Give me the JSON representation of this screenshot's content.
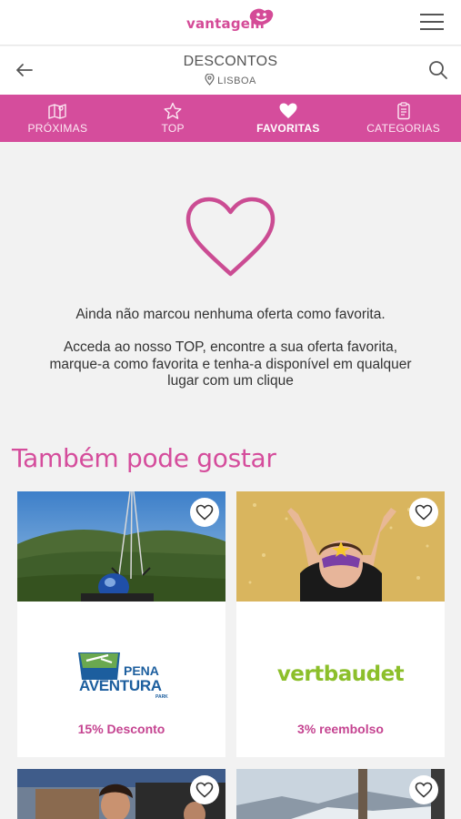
{
  "brand": {
    "name": "vantagem",
    "color": "#d54d9c"
  },
  "header": {
    "title": "DESCONTOS",
    "location": "LISBOA"
  },
  "tabs": [
    {
      "label": "PRÓXIMAS",
      "icon": "map-icon",
      "active": false
    },
    {
      "label": "TOP",
      "icon": "star-icon",
      "active": false
    },
    {
      "label": "FAVORITAS",
      "icon": "heart-icon",
      "active": true
    },
    {
      "label": "CATEGORIAS",
      "icon": "clipboard-icon",
      "active": false
    }
  ],
  "empty_state": {
    "message": "Ainda não marcou nenhuma oferta como favorita.",
    "hint": "Acceda ao nosso TOP, encontre a sua oferta favorita, marque-a como favorita e tenha-a disponível em qualquer lugar com um clique"
  },
  "recommendations": {
    "title": "Também pode gostar",
    "cards": [
      {
        "brand_text_1": "PENA",
        "brand_text_2": "AVENTURA",
        "brand_text_3": "PARK",
        "deal": "15% Desconto"
      },
      {
        "brand_text": "vertbaudet",
        "deal": "3% reembolso"
      }
    ]
  }
}
